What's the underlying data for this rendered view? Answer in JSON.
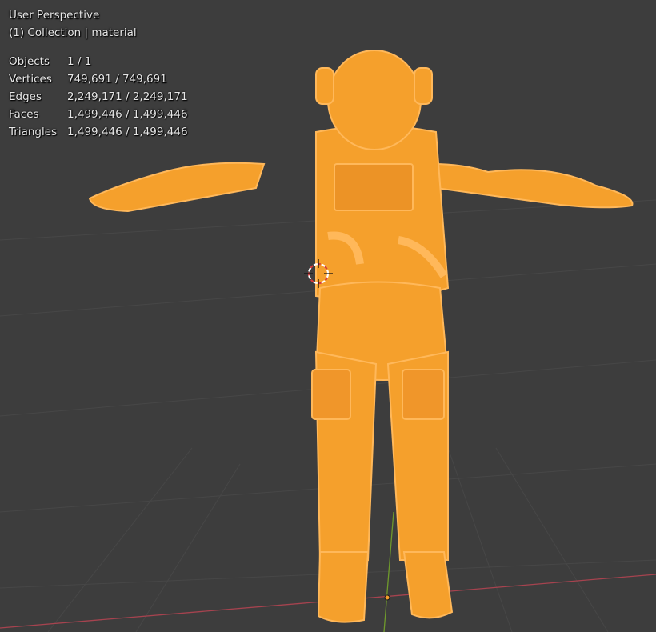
{
  "viewport": {
    "view_name": "User Perspective",
    "collection_line": "(1) Collection | material",
    "colors": {
      "background": "#3d3d3d",
      "selection": "#f5a02c",
      "selection_outline": "#ffb85a",
      "x_axis": "#a6434f",
      "y_axis": "#6f9a2c"
    }
  },
  "stats": [
    {
      "label": "Objects",
      "value": "1 / 1"
    },
    {
      "label": "Vertices",
      "value": "749,691 / 749,691"
    },
    {
      "label": "Edges",
      "value": "2,249,171 / 2,249,171"
    },
    {
      "label": "Faces",
      "value": "1,499,446 / 1,499,446"
    },
    {
      "label": "Triangles",
      "value": "1,499,446 / 1,499,446"
    }
  ],
  "icons": {
    "cursor": "3d-cursor-icon",
    "origin": "object-origin-icon"
  }
}
